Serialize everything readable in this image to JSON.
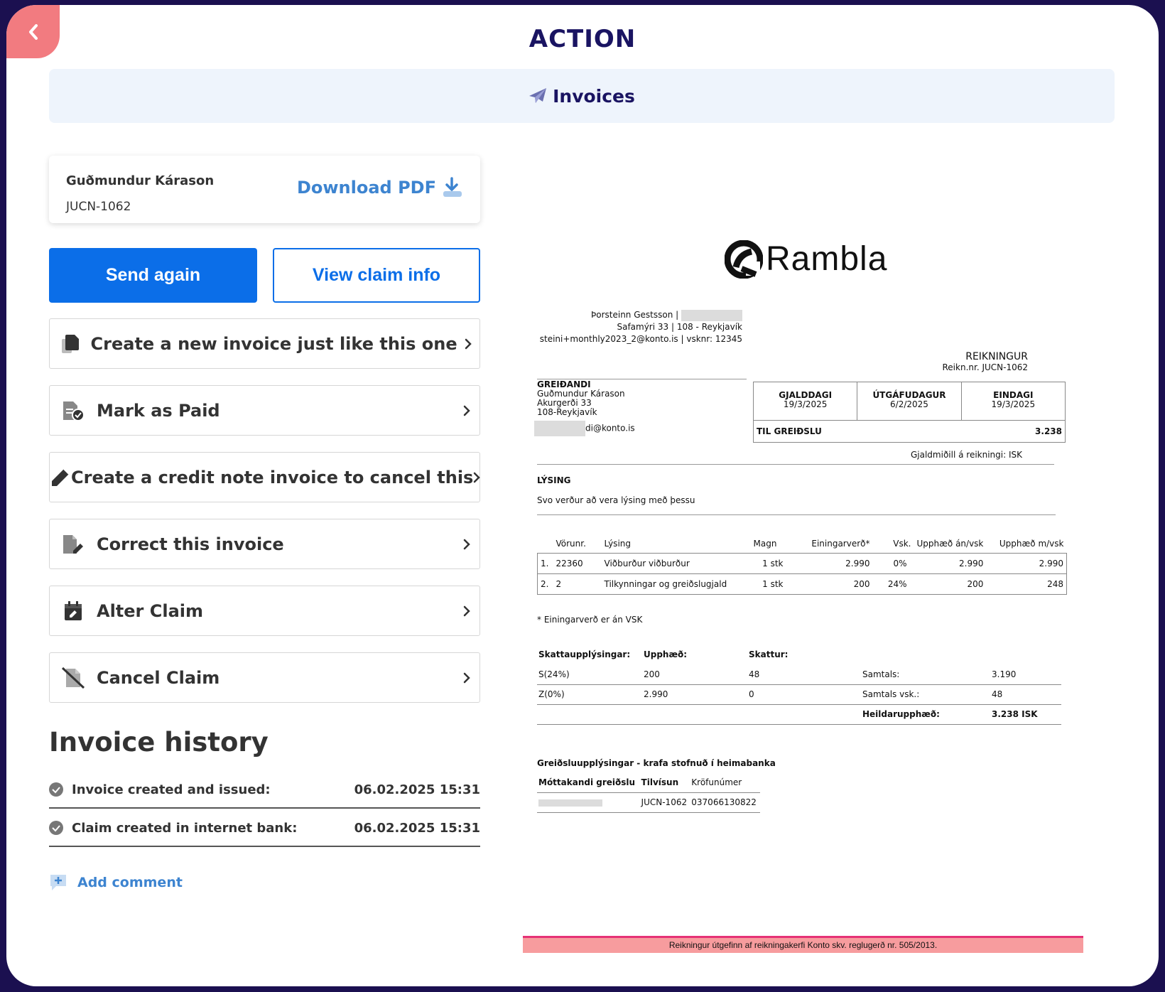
{
  "header": {
    "title": "ACTION",
    "back_icon": "chevron-left-icon",
    "banner_label": "Invoices",
    "banner_icon": "paper-plane-icon"
  },
  "invoice_card": {
    "name": "Guðmundur Kárason",
    "reference": "JUCN-1062",
    "download_label": "Download PDF"
  },
  "buttons": {
    "send_again": "Send again",
    "view_claim_info": "View claim info"
  },
  "actions": [
    {
      "label": "Create a new invoice just like this one",
      "icon": "copy-document-icon"
    },
    {
      "label": "Mark as Paid",
      "icon": "document-check-icon"
    },
    {
      "label": "Create a credit note invoice to cancel this",
      "icon": "pencil-icon"
    },
    {
      "label": "Correct this invoice",
      "icon": "file-edit-icon"
    },
    {
      "label": "Alter Claim",
      "icon": "calendar-edit-icon"
    },
    {
      "label": "Cancel Claim",
      "icon": "file-cancel-icon"
    }
  ],
  "history": {
    "title": "Invoice history",
    "entries": [
      {
        "label": "Invoice created and issued:",
        "date": "06.02.2025 15:31"
      },
      {
        "label": "Claim created in internet bank:",
        "date": "06.02.2025 15:31"
      }
    ],
    "add_comment": "Add comment"
  },
  "document": {
    "logo_text": "Rambla",
    "sender": {
      "line1": "Þorsteinn Gestsson |",
      "line2": "Safamýri 33 | 108 - Reykjavík",
      "line3": "steini+monthly2023_2@konto.is | vsknr: 12345"
    },
    "doc_type": "REIKNINGUR",
    "doc_number": "Reikn.nr. JUCN-1062",
    "payer": {
      "heading": "GREIÐANDI",
      "name": "Guðmundur Kárason",
      "address": "Akurgerði 33",
      "city": "108-Reykjavík",
      "email_partial": "di@konto.is"
    },
    "dates": {
      "due_label": "GJALDDAGI",
      "due": "19/3/2025",
      "issue_label": "ÚTGÁFUDAGUR",
      "issue": "6/2/2025",
      "final_label": "EINDAGI",
      "final": "19/3/2025"
    },
    "to_pay_label": "TIL GREIÐSLU",
    "to_pay": "3.238",
    "currency_note": "Gjaldmiðill á reikningi: ISK",
    "description_heading": "LÝSING",
    "description": "Svo verður að vera lýsing með þessu",
    "lines_header": [
      "Vörunr.",
      "Lýsing",
      "Magn",
      "Einingarverð*",
      "Vsk.",
      "Upphæð án/vsk",
      "Upphæð m/vsk"
    ],
    "lines": [
      {
        "no": "1.",
        "item": "22360",
        "desc": "Viðburður viðburður",
        "qty": "1 stk",
        "unit": "2.990",
        "vat": "0%",
        "net": "2.990",
        "gross": "2.990"
      },
      {
        "no": "2.",
        "item": "2",
        "desc": "Tilkynningar og greiðslugjald",
        "qty": "1 stk",
        "unit": "200",
        "vat": "24%",
        "net": "200",
        "gross": "248"
      }
    ],
    "unit_note": "* Einingarverð er án VSK",
    "tax": {
      "h1": "Skattaupplýsingar:",
      "h2": "Upphæð:",
      "h3": "Skattur:",
      "rows": [
        {
          "code": "S(24%)",
          "amount": "200",
          "tax": "48",
          "sum_label": "Samtals:",
          "sum": "3.190"
        },
        {
          "code": "Z(0%)",
          "amount": "2.990",
          "tax": "0",
          "sum_label": "Samtals vsk.:",
          "sum": "48"
        }
      ],
      "total_label": "Heildarupphæð:",
      "total": "3.238 ISK"
    },
    "payment": {
      "heading": "Greiðsluupplýsingar - krafa stofnuð í heimabanka",
      "h1": "Móttakandi greiðslu",
      "h2": "Tilvísun",
      "h3": "Kröfunúmer",
      "ref": "JUCN-1062",
      "claim_no": "037066130822"
    },
    "footer": "Reikningur útgefinn af reikningakerfi Konto skv. reglugerð nr. 505/2013."
  }
}
